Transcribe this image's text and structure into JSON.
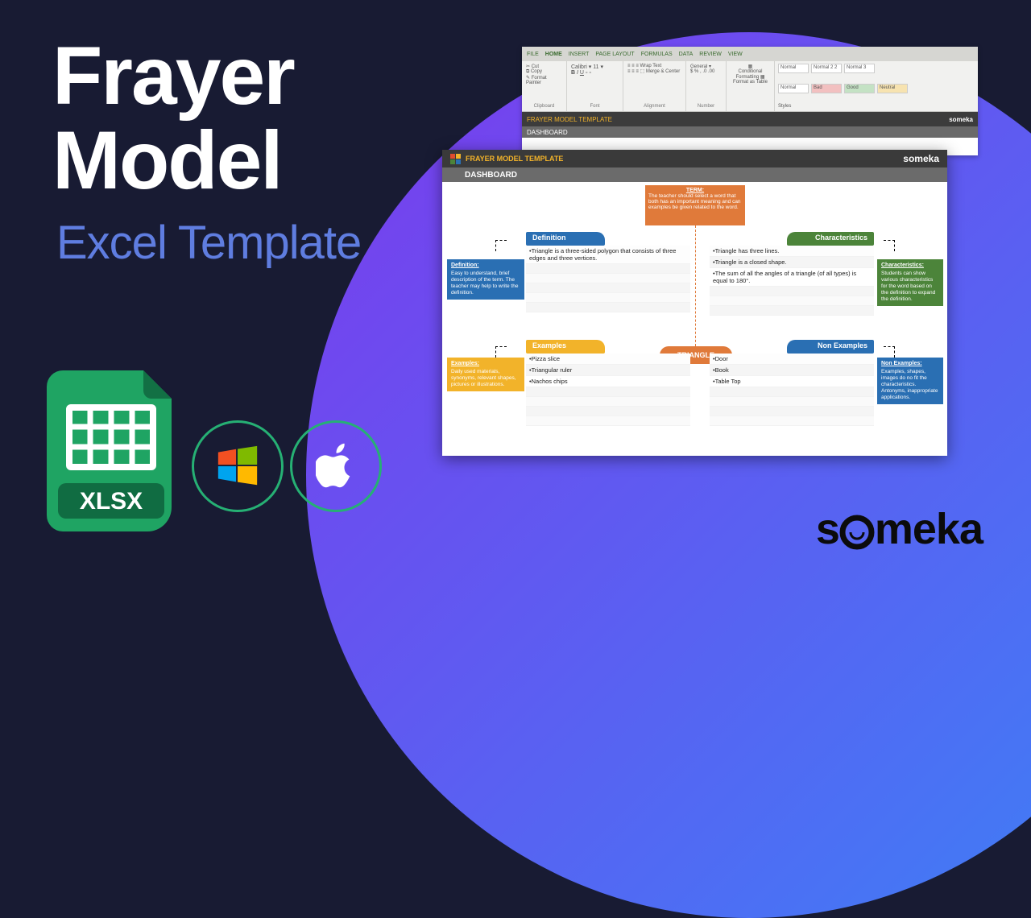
{
  "title": {
    "main_line1": "Frayer",
    "main_line2": "Model",
    "sub": "Excel Template"
  },
  "brand": "someka",
  "xlsx_badge": "XLSX",
  "excel_ribbon": {
    "tabs": [
      "FILE",
      "HOME",
      "INSERT",
      "PAGE LAYOUT",
      "FORMULAS",
      "DATA",
      "REVIEW",
      "VIEW"
    ],
    "clipboard": {
      "cut": "Cut",
      "copy": "Copy",
      "fp": "Format Painter",
      "label": "Clipboard"
    },
    "font_label": "Font",
    "alignment": {
      "wrap": "Wrap Text",
      "merge": "Merge & Center",
      "label": "Alignment"
    },
    "number_label": "Number",
    "cond": "Conditional Formatting",
    "fat": "Format as Table",
    "styles_label": "Styles",
    "styles_row1": [
      "Normal",
      "Normal 2 2",
      "Normal 3"
    ],
    "styles_row2": [
      "Normal",
      "Bad",
      "Good",
      "Neutral"
    ],
    "header_strip_title": "FRAYER MODEL TEMPLATE",
    "header_strip_sub": "DASHBOARD"
  },
  "board": {
    "header_title": "FRAYER MODEL TEMPLATE",
    "header_sub": "DASHBOARD",
    "term": {
      "head": "TERM:",
      "body": "The teacher should select a word that both has an important meaning and can examples be given related to the word."
    },
    "center_word": "TRIANGLE",
    "quadrants": {
      "definition": {
        "tab": "Definition",
        "lines": [
          "•Triangle is a three-sided polygon that consists of three edges and three vertices."
        ]
      },
      "characteristics": {
        "tab": "Characteristics",
        "lines": [
          "•Triangle has three lines.",
          "•Triangle is a closed shape.",
          "•The sum of all the angles of a triangle (of all types) is equal to 180°."
        ]
      },
      "examples": {
        "tab": "Examples",
        "lines": [
          "•Pizza slice",
          "•Triangular ruler",
          "•Nachos chips"
        ]
      },
      "nonexamples": {
        "tab": "Non Examples",
        "lines": [
          "•Door",
          "•Book",
          "•Table Top"
        ]
      }
    },
    "callouts": {
      "definition": {
        "head": "Definition:",
        "body": "Easy to understand, brief description of the term. The teacher may help to write the definition."
      },
      "characteristics": {
        "head": "Characteristics:",
        "body": "Students can show various characteristics for the word based on the definition to expand the definition."
      },
      "examples": {
        "head": "Examples:",
        "body": "Daily used materials, synonyms, relevant shapes, pictures or illustrations."
      },
      "nonexamples": {
        "head": "Non Examples:",
        "body": "Examples, shapes, images do no fit the characteristics. Antonyms, inappropriate applications."
      }
    }
  }
}
